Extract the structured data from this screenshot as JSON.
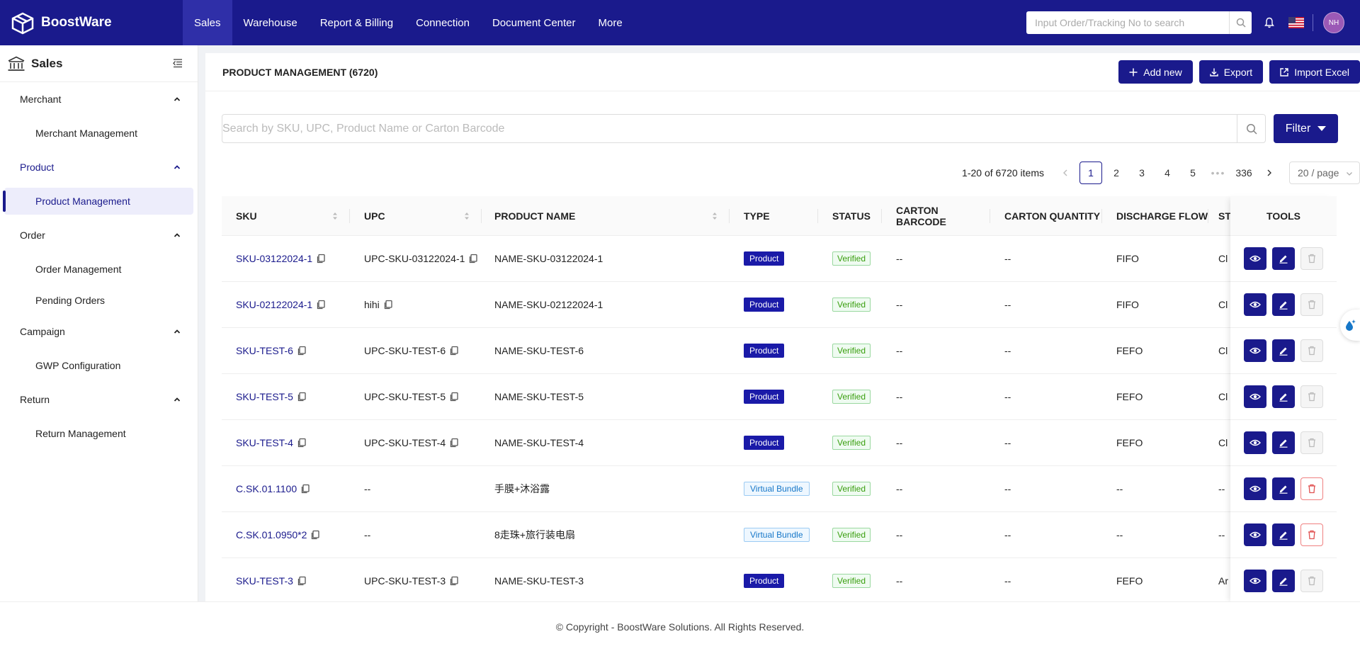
{
  "app": {
    "name": "BoostWare"
  },
  "topnav": [
    "Sales",
    "Warehouse",
    "Report & Billing",
    "Connection",
    "Document Center",
    "More"
  ],
  "search": {
    "placeholder": "Input Order/Tracking No to search"
  },
  "user": {
    "initials": "NH"
  },
  "sidebar": {
    "title": "Sales",
    "groups": [
      {
        "label": "Merchant",
        "items": [
          "Merchant Management"
        ]
      },
      {
        "label": "Product",
        "items": [
          "Product Management"
        ]
      },
      {
        "label": "Order",
        "items": [
          "Order Management",
          "Pending Orders"
        ]
      },
      {
        "label": "Campaign",
        "items": [
          "GWP Configuration"
        ]
      },
      {
        "label": "Return",
        "items": [
          "Return Management"
        ]
      }
    ]
  },
  "page": {
    "title": "PRODUCT MANAGEMENT (6720)",
    "buttons": {
      "add": "Add new",
      "export": "Export",
      "import": "Import Excel"
    },
    "search_placeholder": "Search by SKU, UPC, Product Name or Carton Barcode",
    "filter": "Filter"
  },
  "pagination": {
    "total": "1-20 of 6720 items",
    "pages": [
      "1",
      "2",
      "3",
      "4",
      "5",
      "•••",
      "336"
    ],
    "page_size": "20 / page"
  },
  "table": {
    "columns": [
      "SKU",
      "UPC",
      "PRODUCT NAME",
      "TYPE",
      "STATUS",
      "CARTON BARCODE",
      "CARTON QUANTITY",
      "DISCHARGE FLOW",
      "ST",
      "TOOLS"
    ],
    "rows": [
      {
        "sku": "SKU-03122024-1",
        "upc": "UPC-SKU-03122024-1",
        "upc_copy": true,
        "name": "NAME-SKU-03122024-1",
        "type": "Product",
        "status": "Verified",
        "carton_barcode": "--",
        "carton_qty": "--",
        "flow": "FIFO",
        "st": "Cl",
        "deletable": false
      },
      {
        "sku": "SKU-02122024-1",
        "upc": "hihi",
        "upc_copy": true,
        "name": "NAME-SKU-02122024-1",
        "type": "Product",
        "status": "Verified",
        "carton_barcode": "--",
        "carton_qty": "--",
        "flow": "FIFO",
        "st": "Cl",
        "deletable": false
      },
      {
        "sku": "SKU-TEST-6",
        "upc": "UPC-SKU-TEST-6",
        "upc_copy": true,
        "name": "NAME-SKU-TEST-6",
        "type": "Product",
        "status": "Verified",
        "carton_barcode": "--",
        "carton_qty": "--",
        "flow": "FEFO",
        "st": "Cl",
        "deletable": false
      },
      {
        "sku": "SKU-TEST-5",
        "upc": "UPC-SKU-TEST-5",
        "upc_copy": true,
        "name": "NAME-SKU-TEST-5",
        "type": "Product",
        "status": "Verified",
        "carton_barcode": "--",
        "carton_qty": "--",
        "flow": "FEFO",
        "st": "Cl",
        "deletable": false
      },
      {
        "sku": "SKU-TEST-4",
        "upc": "UPC-SKU-TEST-4",
        "upc_copy": true,
        "name": "NAME-SKU-TEST-4",
        "type": "Product",
        "status": "Verified",
        "carton_barcode": "--",
        "carton_qty": "--",
        "flow": "FEFO",
        "st": "Cl",
        "deletable": false
      },
      {
        "sku": "C.SK.01.1100",
        "upc": "--",
        "upc_copy": false,
        "name": "手膜+沐浴露",
        "type": "Virtual Bundle",
        "status": "Verified",
        "carton_barcode": "--",
        "carton_qty": "--",
        "flow": "--",
        "st": "--",
        "deletable": true
      },
      {
        "sku": "C.SK.01.0950*2",
        "upc": "--",
        "upc_copy": false,
        "name": "8走珠+旅行装电扇",
        "type": "Virtual Bundle",
        "status": "Verified",
        "carton_barcode": "--",
        "carton_qty": "--",
        "flow": "--",
        "st": "--",
        "deletable": true
      },
      {
        "sku": "SKU-TEST-3",
        "upc": "UPC-SKU-TEST-3",
        "upc_copy": true,
        "name": "NAME-SKU-TEST-3",
        "type": "Product",
        "status": "Verified",
        "carton_barcode": "--",
        "carton_qty": "--",
        "flow": "FEFO",
        "st": "Ar",
        "deletable": false
      }
    ]
  },
  "footer": "© Copyright - BoostWare Solutions. All Rights Reserved.",
  "colors": {
    "primary": "#1a1a8c",
    "nav_active": "#2f2fa8",
    "verified": "#389e0d",
    "bundle": "#1677c8",
    "delete": "#f08080"
  }
}
